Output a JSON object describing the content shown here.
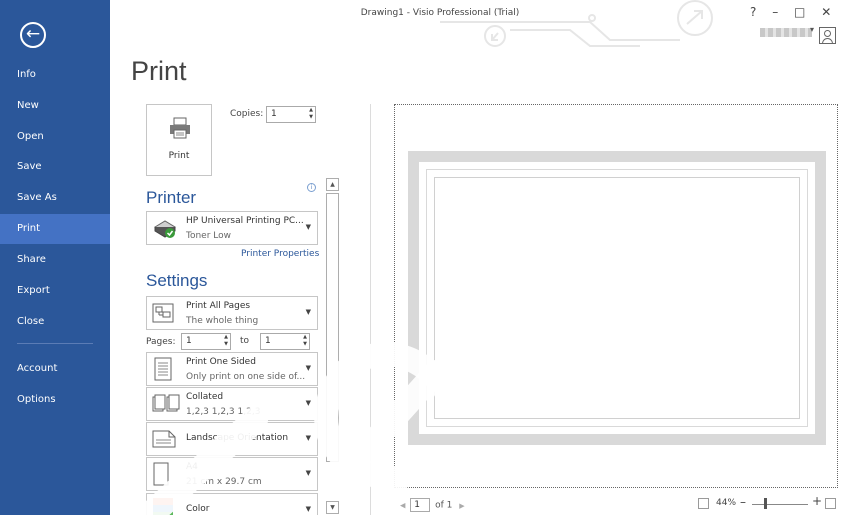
{
  "window": {
    "title": "Drawing1 - Visio Professional (Trial)",
    "help": "?",
    "minimize": "–",
    "restore": "□",
    "close": "✕",
    "user_dropdown_arrow": "▾"
  },
  "backstage": {
    "back_icon": "back-arrow-icon",
    "items": [
      {
        "label": "Info"
      },
      {
        "label": "New"
      },
      {
        "label": "Open"
      },
      {
        "label": "Save"
      },
      {
        "label": "Save As"
      },
      {
        "label": "Print",
        "active": true
      },
      {
        "label": "Share"
      },
      {
        "label": "Export"
      },
      {
        "label": "Close"
      },
      {
        "label": "Account"
      },
      {
        "label": "Options"
      }
    ],
    "colors": {
      "sidebar": "#2b579a",
      "active": "#4472c4"
    }
  },
  "print": {
    "heading": "Print",
    "print_button": "Print",
    "copies_label": "Copies:",
    "copies_value": "1"
  },
  "printer": {
    "heading": "Printer",
    "name": "HP Universal Printing PC...",
    "status": "Toner Low",
    "properties_link": "Printer Properties"
  },
  "settings": {
    "heading": "Settings",
    "pages_label": "Pages:",
    "pages_from": "1",
    "to_label": "to",
    "pages_to": "1",
    "dropdowns": [
      {
        "line1": "Print All Pages",
        "line2": "The whole thing"
      },
      {
        "line1": "Print One Sided",
        "line2": "Only print on one side of..."
      },
      {
        "line1": "Collated",
        "line2": "1,2,3    1,2,3    1,2,3"
      },
      {
        "line1": "Landscape Orientation",
        "line2": ""
      },
      {
        "line1": "A4",
        "line2": "21 cm x 29.7 cm"
      },
      {
        "line1": "Color",
        "line2": ""
      }
    ]
  },
  "preview": {
    "page_current": "1",
    "page_of": "of 1",
    "prev_arrow": "◀",
    "next_arrow": "▶",
    "zoom_percent": "44%",
    "zoom_minus": "–",
    "zoom_plus": "+",
    "zoom_level": 0.44
  }
}
